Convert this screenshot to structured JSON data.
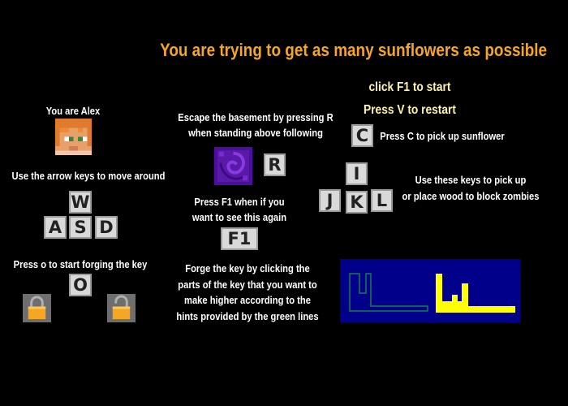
{
  "title": "You are trying to get as many sunflowers as possible",
  "start_text": "click F1 to start",
  "restart_text": "Press V to restart",
  "pickup_sunflower_text": "Press C to pick up sunflower",
  "you_are_text": "You are Alex",
  "basement_text_1": "Escape the basement by pressing R",
  "basement_text_2": "when standing above following",
  "move_text": "Use the arrow keys to move around",
  "f1_again_text_1": "Press F1 when if you",
  "f1_again_text_2": "want to see this again",
  "wood_text_1": "Use these keys to pick up",
  "wood_text_2": "or place wood to block zombies",
  "forge_start_text": "Press o to start forging the key",
  "forge_text": [
    "Forge the key by clicking the",
    "parts of the key that you want to",
    "make higher according to the",
    "hints provided by the green lines"
  ],
  "keys": {
    "c": "C",
    "r": "R",
    "i": "I",
    "j": "J",
    "k": "K",
    "l": "L",
    "w": "W",
    "a": "A",
    "s": "S",
    "d": "D",
    "f1": "F1",
    "o": "O"
  },
  "icons": [
    "alex-face-icon",
    "portal-block-icon",
    "locked-padlock-icon",
    "unlocked-padlock-icon"
  ],
  "colors": {
    "title": "#f5a623",
    "yellow_text": "#fff3a8",
    "key_panel_bg": "#00008b",
    "hint_line": "#1a7a4a",
    "key_shape": "#ffff00",
    "portal": "#5a1aa8"
  }
}
